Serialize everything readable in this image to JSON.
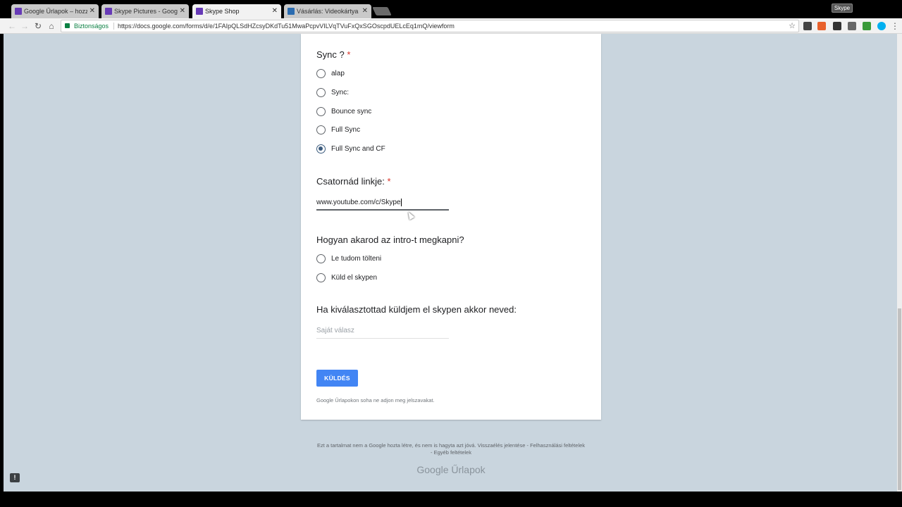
{
  "browser": {
    "tabs": [
      {
        "title": "Google Űrlapok – hozzá",
        "icon_color": "#673ab7",
        "active": false
      },
      {
        "title": "Skype Pictures - Google",
        "icon_color": "#673ab7",
        "active": false
      },
      {
        "title": "Skype Shop",
        "icon_color": "#673ab7",
        "active": true
      },
      {
        "title": "Vásárlás: Videokártya ár",
        "icon_color": "#2b6cb0",
        "active": false
      }
    ],
    "close_glyph": "✕",
    "skype_badge": "Skype",
    "secure_label": "Biztonságos",
    "url": "https://docs.google.com/forms/d/e/1FAIpQLSdHZcsyDKdTu51MwaPcpvVILVqTVuFxQxSGOscpdUELcEq1mQ/viewform",
    "star_icon": "☆"
  },
  "form": {
    "q1": {
      "title": "Sync ?",
      "required_mark": "*",
      "options": [
        "alap",
        "Sync:",
        "Bounce sync",
        "Full Sync",
        "Full Sync and CF"
      ],
      "selected": "Full Sync and CF"
    },
    "q2": {
      "title": "Csatornád linkje:",
      "required_mark": "*",
      "value": "www.youtube.com/c/Skype"
    },
    "q3": {
      "title": "Hogyan akarod az intro-t megkapni?",
      "options": [
        "Le tudom tölteni",
        "Küld el skypen"
      ]
    },
    "q4": {
      "title": "Ha kiválasztottad küldjem el skypen akkor neved:",
      "placeholder": "Saját válasz"
    },
    "submit_label": "KÜLDÉS",
    "password_note": "Google Űrlapokon soha ne adjon meg jelszavakat."
  },
  "footer": {
    "line1": "Ezt a tartalmat nem a Google hozta létre, és nem is hagyta azt jóvá. Visszaélés jelentése - Felhasználási feltételek",
    "line2": "- Egyéb feltételek",
    "brand": "Google Űrlapok"
  },
  "feedback_icon": "!"
}
